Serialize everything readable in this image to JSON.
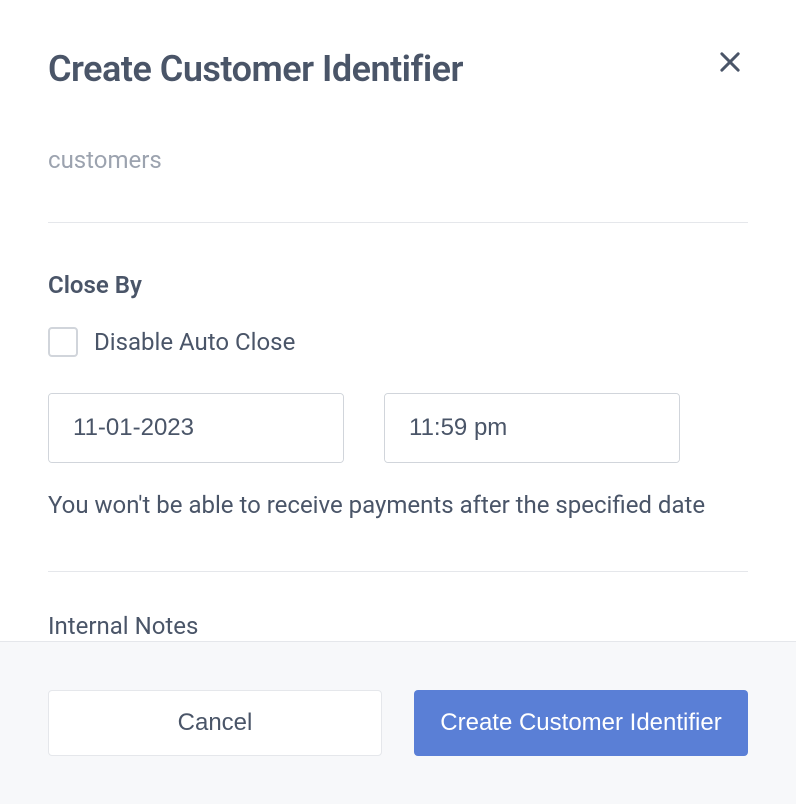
{
  "modal": {
    "title": "Create Customer Identifier",
    "partialText": "customers",
    "closeBy": {
      "label": "Close By",
      "checkboxLabel": "Disable Auto Close",
      "date": "11-01-2023",
      "time": "11:59 pm",
      "helperText": "You won't be able to receive payments after the specified date"
    },
    "internalNotes": {
      "label": "Internal Notes"
    },
    "footer": {
      "cancelLabel": "Cancel",
      "submitLabel": "Create Customer Identifier"
    }
  }
}
